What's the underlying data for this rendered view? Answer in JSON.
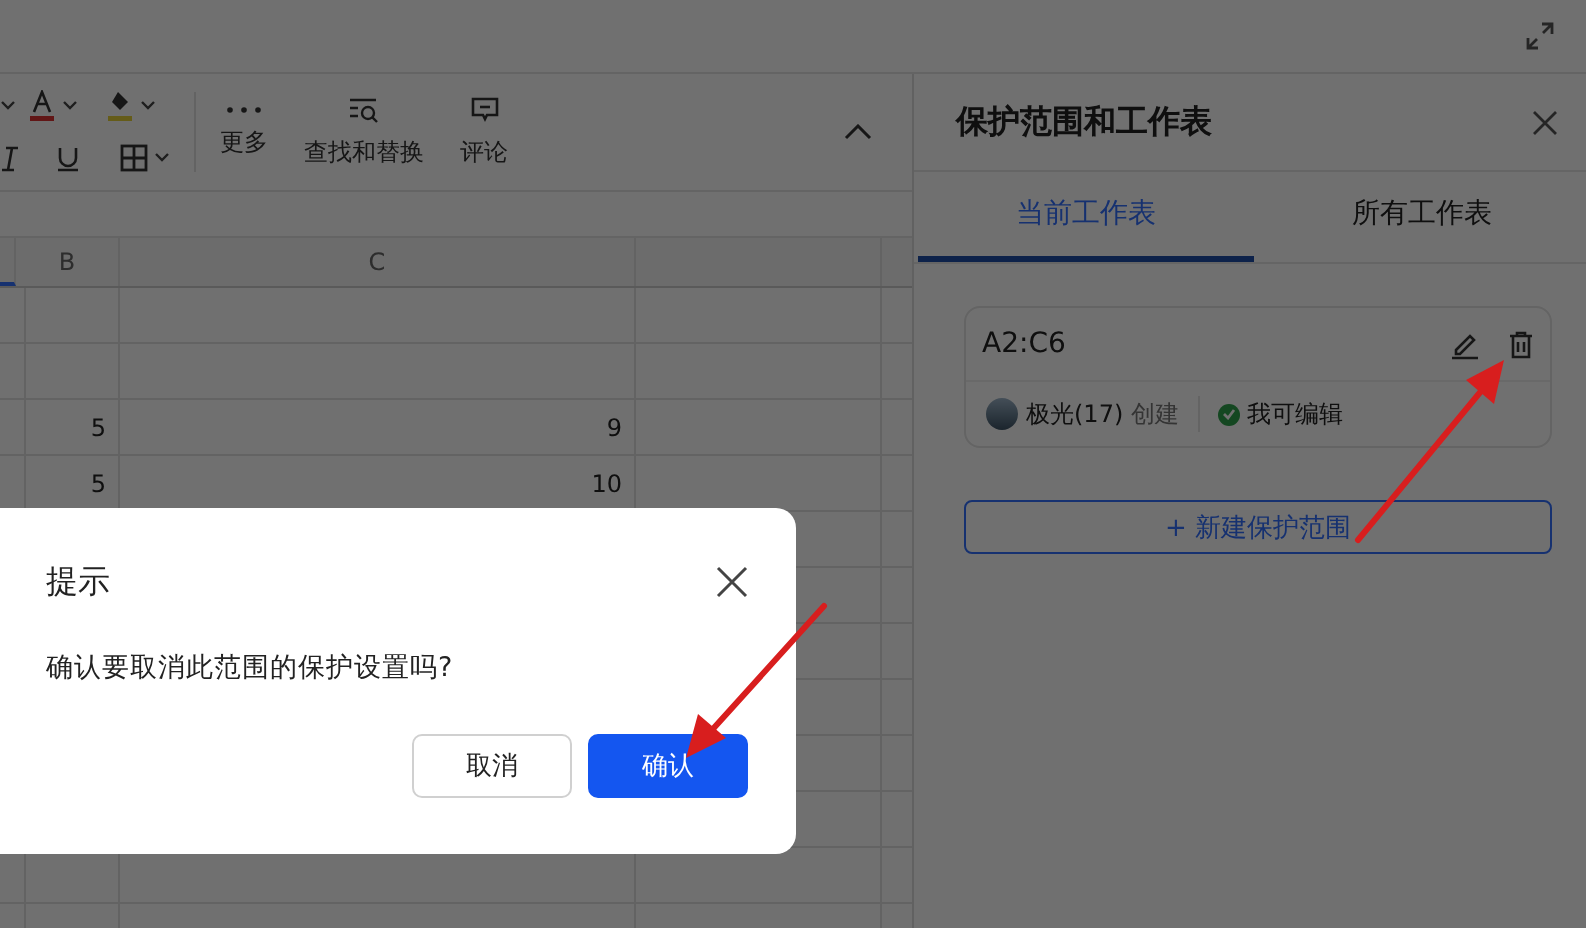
{
  "toolbar": {
    "commands": [
      {
        "label": "更多",
        "kind": "more"
      },
      {
        "label": "查找和替换",
        "kind": "find"
      },
      {
        "label": "评论",
        "kind": "comment"
      }
    ]
  },
  "sheet": {
    "columns": [
      "B",
      "C"
    ],
    "rows": [
      {
        "b": "5",
        "c": "9"
      },
      {
        "b": "5",
        "c": "10"
      }
    ]
  },
  "panel": {
    "title": "保护范围和工作表",
    "tabs": [
      {
        "label": "当前工作表",
        "selected": true
      },
      {
        "label": "所有工作表",
        "selected": false
      }
    ],
    "ranges": [
      {
        "range": "A2:C6",
        "creator": "极光(17)",
        "created_label": "创建",
        "permission": "我可编辑"
      }
    ],
    "add_button": "+ 新建保护范围"
  },
  "dialog": {
    "title": "提示",
    "message": "确认要取消此范围的保护设置吗?",
    "buttons": [
      {
        "label": "取消",
        "kind": "secondary"
      },
      {
        "label": "确认",
        "kind": "primary"
      }
    ]
  }
}
